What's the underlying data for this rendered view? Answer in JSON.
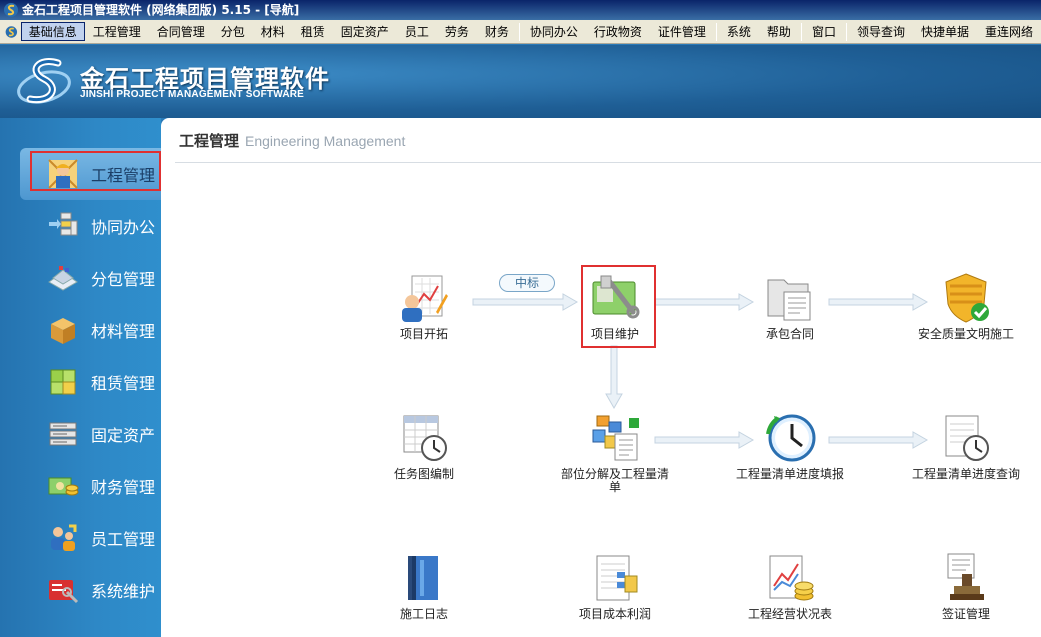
{
  "window": {
    "title": "金石工程项目管理软件 (网络集团版) 5.15 - [导航]"
  },
  "menubar": {
    "items": [
      "基础信息",
      "工程管理",
      "合同管理",
      "分包",
      "材料",
      "租赁",
      "固定资产",
      "员工",
      "劳务",
      "财务",
      "协同办公",
      "行政物资",
      "证件管理",
      "系统",
      "帮助",
      "窗口",
      "领导查询",
      "快捷单据",
      "重连网络"
    ],
    "active_index": 0
  },
  "header": {
    "brand_cn": "金石工程项目管理软件",
    "brand_en": "JINSHI PROJECT MANAGEMENT SOFTWARE"
  },
  "sidebar": {
    "items": [
      {
        "label": "工程管理",
        "icon": "engineer-icon",
        "selected": true
      },
      {
        "label": "协同办公",
        "icon": "collaboration-icon"
      },
      {
        "label": "分包管理",
        "icon": "subcontract-icon"
      },
      {
        "label": "材料管理",
        "icon": "material-box-icon"
      },
      {
        "label": "租赁管理",
        "icon": "lease-cubes-icon"
      },
      {
        "label": "固定资产",
        "icon": "server-rack-icon"
      },
      {
        "label": "财务管理",
        "icon": "money-icon"
      },
      {
        "label": "员工管理",
        "icon": "staff-icon"
      },
      {
        "label": "系统维护",
        "icon": "system-tools-icon"
      }
    ]
  },
  "main": {
    "title_cn": "工程管理",
    "title_en": "Engineering Management",
    "flow_label": "中标",
    "nodes": [
      {
        "label": "项目开拓",
        "icon": "project-develop-icon"
      },
      {
        "label": "项目维护",
        "icon": "project-maintain-icon"
      },
      {
        "label": "承包合同",
        "icon": "contract-folder-icon"
      },
      {
        "label": "安全质量文明施工",
        "icon": "safety-shield-icon"
      },
      {
        "label": "任务图编制",
        "icon": "task-schedule-icon"
      },
      {
        "label": "部位分解及工程量清单",
        "icon": "breakdown-icon"
      },
      {
        "label": "工程量清单进度填报",
        "icon": "progress-clock-icon"
      },
      {
        "label": "工程量清单进度查询",
        "icon": "progress-query-icon"
      },
      {
        "label": "施工日志",
        "icon": "construction-log-icon"
      },
      {
        "label": "项目成本利润",
        "icon": "cost-profit-icon"
      },
      {
        "label": "工程经营状况表",
        "icon": "business-status-icon"
      },
      {
        "label": "签证管理",
        "icon": "visa-stamp-icon"
      }
    ]
  }
}
